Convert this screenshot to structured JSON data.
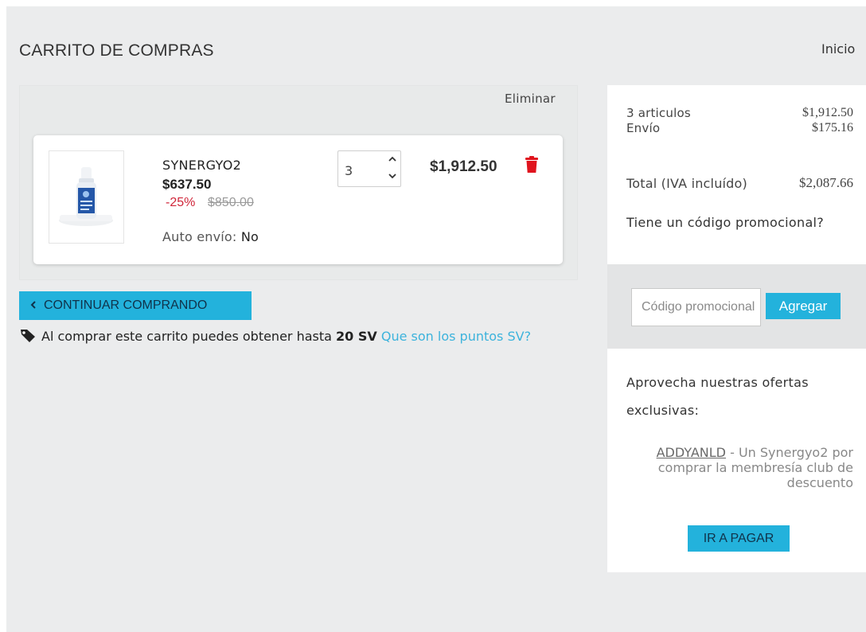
{
  "header": {
    "title": "CARRITO DE COMPRAS",
    "home_link": "Inicio"
  },
  "cart": {
    "remove_header": "Eliminar",
    "items": [
      {
        "name": "SYNERGYO2",
        "price": "$637.50",
        "discount": "-25%",
        "original_price": "$850.00",
        "auto_ship_label": "Auto envío:",
        "auto_ship_value": "No",
        "quantity": "3",
        "line_total": "$1,912.50",
        "image_alt": "synergyo2-bottle"
      }
    ],
    "continue_button": "CONTINUAR COMPRANDO",
    "sv_text_before": "Al comprar este carrito puedes obtener hasta",
    "sv_points": "20 SV",
    "sv_link": "Que son los puntos SV?"
  },
  "summary": {
    "items_label": "3 articulos",
    "items_value": "$1,912.50",
    "shipping_label": "Envío",
    "shipping_value": "$175.16",
    "total_label": "Total (IVA incluído)",
    "total_value": "$2,087.66",
    "promo_question": "Tiene un código promocional?"
  },
  "promo": {
    "placeholder": "Código promocional",
    "add_button": "Agregar"
  },
  "offers": {
    "title": "Aprovecha nuestras ofertas exclusivas:",
    "code": "ADDYANLD",
    "description": " - Un Synergyo2 por comprar la membresía club de descuento",
    "pay_button": "IR A PAGAR"
  },
  "colors": {
    "accent": "#23b2dc",
    "discount": "#d0263a",
    "trash": "#e0141e",
    "link": "#3db3dc"
  },
  "icons": {
    "remove": "trash-icon",
    "tag": "tag-icon",
    "continue": "chevron-left-icon",
    "qty_up": "chevron-up-icon",
    "qty_down": "chevron-down-icon"
  }
}
